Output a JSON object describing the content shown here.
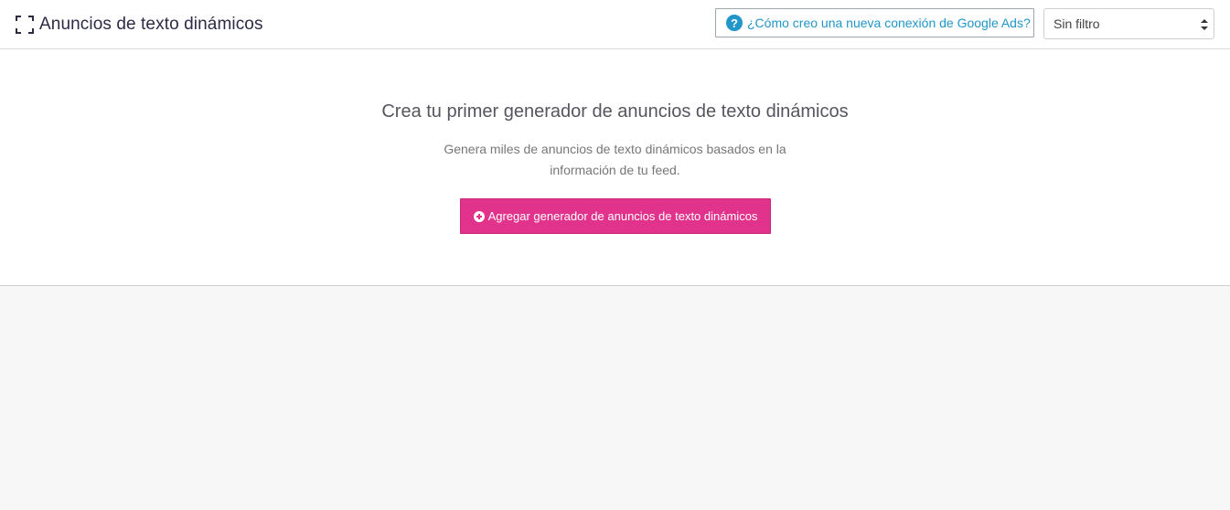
{
  "header": {
    "title": "Anuncios de texto dinámicos",
    "help_link": "¿Cómo creo una nueva conexión de Google Ads?",
    "filter_selected": "Sin filtro"
  },
  "empty_state": {
    "heading": "Crea tu primer generador de anuncios de texto dinámicos",
    "description": "Genera miles de anuncios de texto dinámicos basados en la información de tu feed.",
    "add_button_label": "Agregar generador de anuncios de texto dinámicos"
  },
  "colors": {
    "accent": "#e2338c",
    "link": "#2196c9"
  },
  "icons": {
    "title": "expand-icon",
    "help": "question-circle-icon",
    "add": "plus-circle-icon",
    "select": "select-arrows-icon"
  }
}
